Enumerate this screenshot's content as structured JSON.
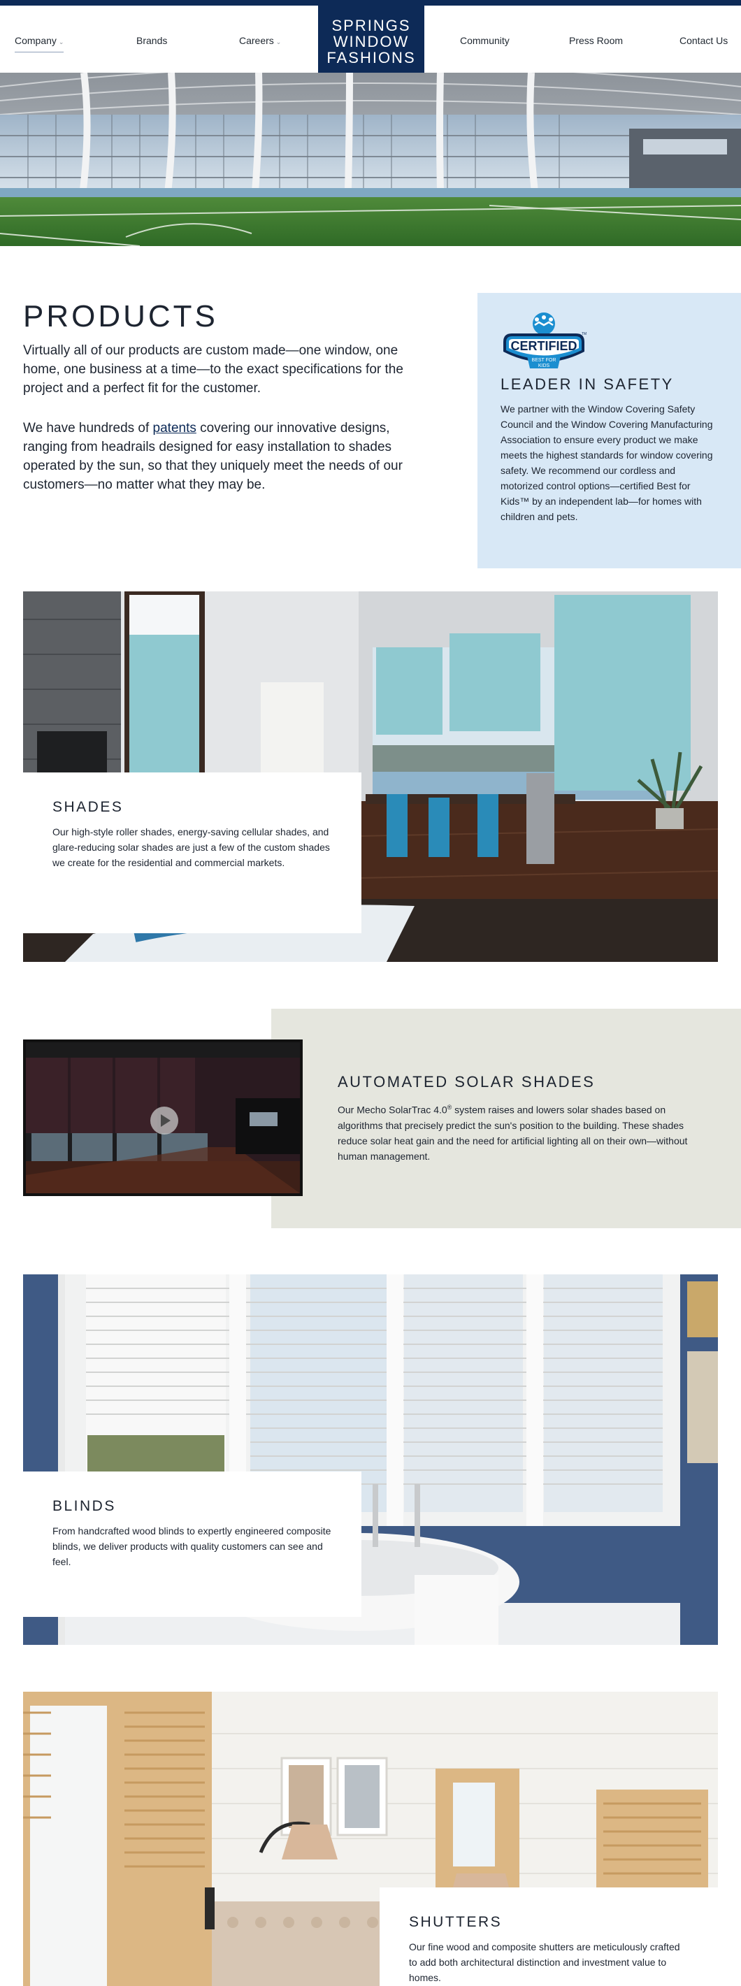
{
  "colors": {
    "brand_navy": "#0d2a57",
    "safety_bg": "#d8e8f6",
    "solar_bg": "#e5e6de",
    "text": "#1d2430"
  },
  "nav": {
    "left_items": [
      {
        "label": "Company",
        "has_dropdown": true,
        "active": true
      },
      {
        "label": "Brands",
        "has_dropdown": false
      },
      {
        "label": "Careers",
        "has_dropdown": true
      }
    ],
    "right_items": [
      {
        "label": "Community"
      },
      {
        "label": "Press Room"
      },
      {
        "label": "Contact Us"
      }
    ],
    "logo_lines": [
      "SPRINGS",
      "WINDOW",
      "FASHIONS"
    ],
    "dropdown_icon": "chevron-down-icon"
  },
  "products": {
    "title": "PRODUCTS",
    "paragraph1": "Virtually all of our products are custom made—one window, one home, one business at a time—to the exact specifications for the project and a perfect fit for the customer.",
    "paragraph2_before": "We have hundreds of ",
    "paragraph2_link": "patents",
    "paragraph2_after": " covering our innovative designs, ranging from headrails designed for easy installation to shades operated by the sun, so that they uniquely meet the needs of our customers—no matter what they may be."
  },
  "safety": {
    "badge_text": "CERTIFIED",
    "badge_sub_lines": [
      "BEST FOR",
      "KIDS"
    ],
    "badge_tm": "TM",
    "title": "LEADER IN SAFETY",
    "text": "We partner with the Window Covering Safety Council and the Window Covering Manufacturing Association to ensure every product we make meets the highest standards for window covering safety. We recommend our cordless and motorized control options—certified Best for Kids™ by an independent lab—for homes with children and pets."
  },
  "shades": {
    "title": "SHADES",
    "text": "Our high-style roller shades, energy-saving cellular shades, and glare-reducing solar shades are just a few of the custom shades we create for the residential and commercial markets."
  },
  "solar": {
    "title": "AUTOMATED SOLAR SHADES",
    "text_before": "Our Mecho SolarTrac 4.0",
    "text_sup": "®",
    "text_after": " system raises and lowers solar shades based on algorithms that precisely predict the sun's position to the building. These shades reduce solar heat gain and the need for artificial lighting all on their own—without human management.",
    "play_icon": "play-icon"
  },
  "blinds": {
    "title": "BLINDS",
    "text": "From handcrafted wood blinds to expertly engineered composite blinds, we deliver products with quality customers can see and feel."
  },
  "shutters": {
    "title": "SHUTTERS",
    "text": "Our fine wood and composite shutters are meticulously crafted to add both architectural distinction and investment value to homes."
  }
}
